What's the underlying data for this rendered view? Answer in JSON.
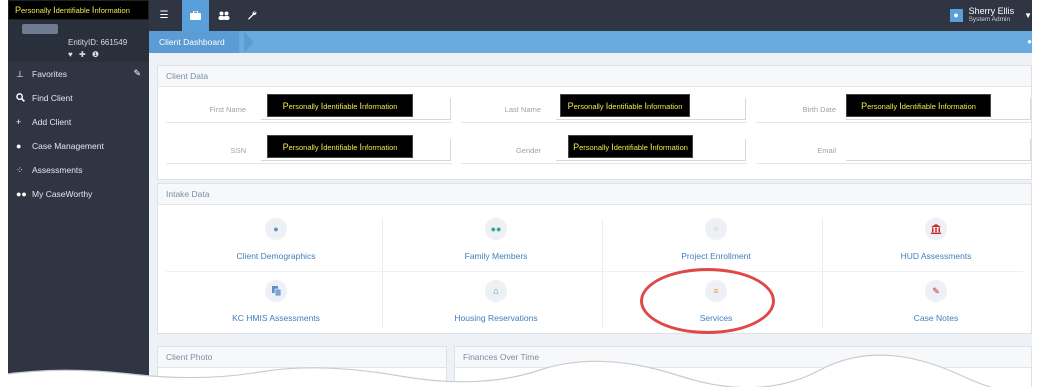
{
  "pii": {
    "part1": "P",
    "part2": "ersonally ",
    "part3": "I",
    "part4": "dentifiable ",
    "part5": "I",
    "part6": "nformation"
  },
  "sidebar": {
    "entity_id": "EntityID: 661549",
    "entity_icons": "♥ ✚ ❶",
    "items": [
      {
        "label": "Favorites",
        "icon": "pin-icon"
      },
      {
        "label": "Find Client",
        "icon": "search-icon"
      },
      {
        "label": "Add Client",
        "icon": "plus-icon"
      },
      {
        "label": "Case Management",
        "icon": "user-icon"
      },
      {
        "label": "Assessments",
        "icon": "spinner-icon"
      },
      {
        "label": "My CaseWorthy",
        "icon": "users-icon"
      }
    ]
  },
  "topbar": {
    "user_name": "Sherry Ellis",
    "user_role": "System Admin"
  },
  "breadcrumb": {
    "current": "Client Dashboard"
  },
  "client_data": {
    "title": "Client Data",
    "first_name_label": "First Name",
    "last_name_label": "Last Name",
    "birth_date_label": "Birth Date",
    "ssn_label": "SSN",
    "gender_label": "Gender",
    "email_label": "Email"
  },
  "intake": {
    "title": "Intake Data",
    "tiles": [
      {
        "label": "Client Demographics",
        "icon": "user-icon"
      },
      {
        "label": "Family Members",
        "icon": "users-icon"
      },
      {
        "label": "Project Enrollment",
        "icon": "spinner-icon"
      },
      {
        "label": "HUD Assessments",
        "icon": "bank-icon"
      },
      {
        "label": "KC HMIS Assessments",
        "icon": "documents-icon"
      },
      {
        "label": "Housing Reservations",
        "icon": "home-icon"
      },
      {
        "label": "Services",
        "icon": "list-icon"
      },
      {
        "label": "Case Notes",
        "icon": "edit-icon"
      }
    ]
  },
  "client_photo": {
    "title": "Client Photo"
  },
  "finances": {
    "title": "Finances Over Time"
  },
  "colors": {
    "sidebar_bg": "#2f3542",
    "accent": "#5a9fd9",
    "link": "#3f7fc0",
    "highlight": "#e04848",
    "pii_text": "#f2e94e"
  }
}
